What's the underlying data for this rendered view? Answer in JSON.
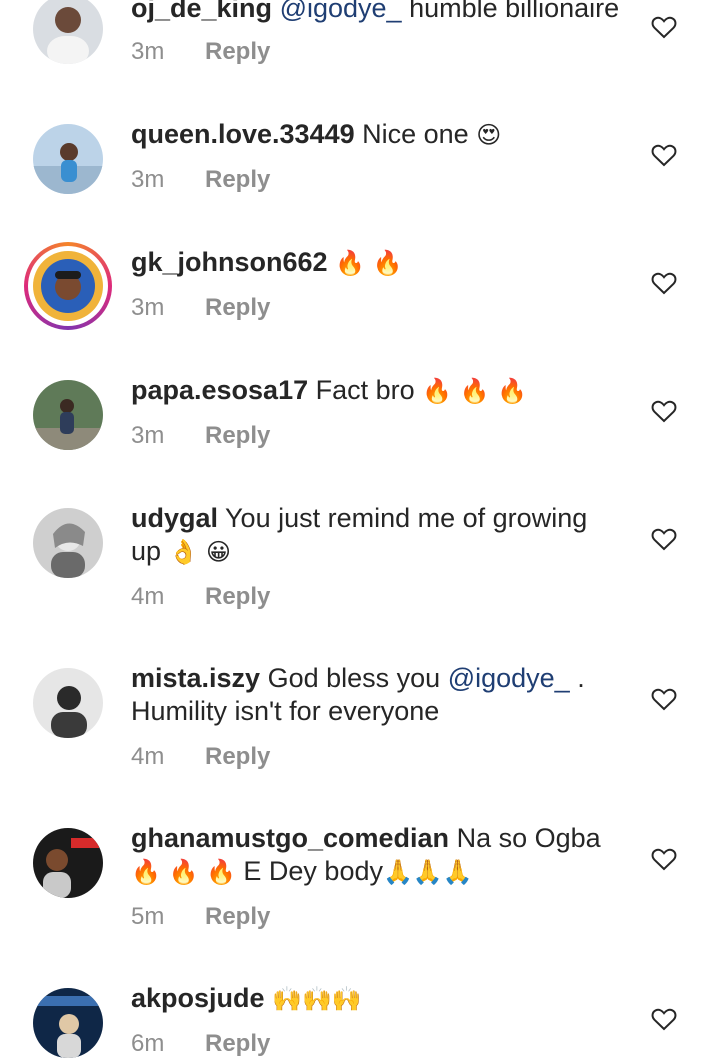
{
  "comments": [
    {
      "username": "oj_de_king",
      "mention": "@igodye_",
      "text": " humble billionaire",
      "text2": "",
      "emoji": "",
      "time": "3m",
      "reply": "Reply"
    },
    {
      "username": "queen.love.33449",
      "mention": "",
      "text": " Nice one ",
      "text2": "",
      "emoji": "😍",
      "time": "3m",
      "reply": "Reply"
    },
    {
      "username": "gk_johnson662",
      "mention": "",
      "text": " ",
      "text2": "",
      "emoji": "🔥 🔥",
      "time": "3m",
      "reply": "Reply"
    },
    {
      "username": "papa.esosa17",
      "mention": "",
      "text": " Fact bro ",
      "text2": "",
      "emoji": "🔥 🔥 🔥",
      "time": "3m",
      "reply": "Reply"
    },
    {
      "username": "udygal",
      "mention": "",
      "text": " You just remind me of growing up ",
      "text2": "",
      "emoji": "👌 😀",
      "time": "4m",
      "reply": "Reply"
    },
    {
      "username": "mista.iszy",
      "mention": "@igodye_",
      "text": " God bless you ",
      "text2": " . Humility isn't for everyone",
      "emoji": "",
      "time": "4m",
      "reply": "Reply"
    },
    {
      "username": "ghanamustgo_comedian",
      "mention": "",
      "text": " Na so Ogba ",
      "text2": " E Dey body",
      "emoji": "🔥 🔥 🔥",
      "emoji2": "🙏🙏🙏",
      "time": "5m",
      "reply": "Reply"
    },
    {
      "username": "akposjude",
      "mention": "",
      "text": " ",
      "text2": "",
      "emoji": "🙌🙌🙌",
      "time": "6m",
      "reply": "Reply"
    }
  ],
  "icons": {
    "like": "heart-outline-icon"
  }
}
